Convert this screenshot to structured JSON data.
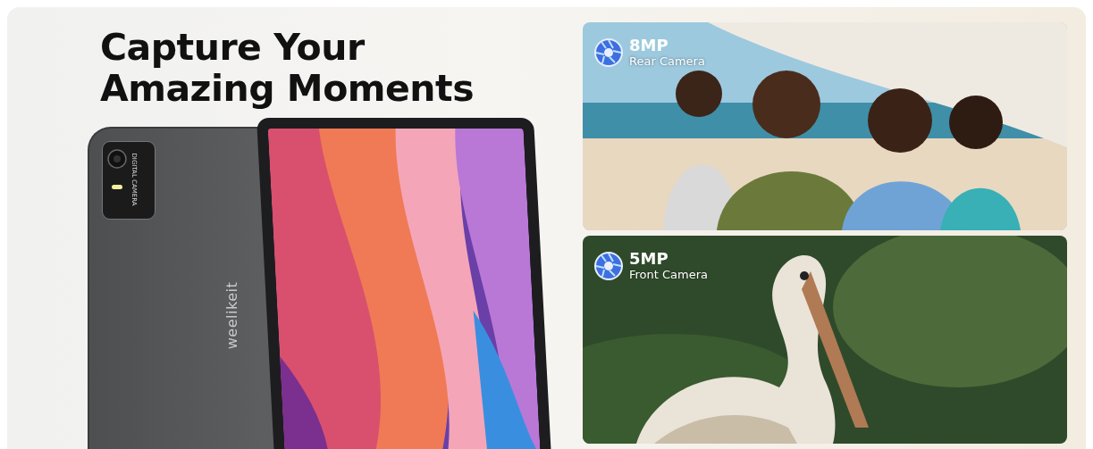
{
  "heading": "Capture Your\nAmazing Moments",
  "device": {
    "brand": "weelikeit",
    "camera_label": "DIGITAL CAMERA"
  },
  "cameras": [
    {
      "kind": "family",
      "resolution": "8MP",
      "label": "Rear Camera"
    },
    {
      "kind": "bird",
      "resolution": "5MP",
      "label": "Front Camera"
    }
  ]
}
